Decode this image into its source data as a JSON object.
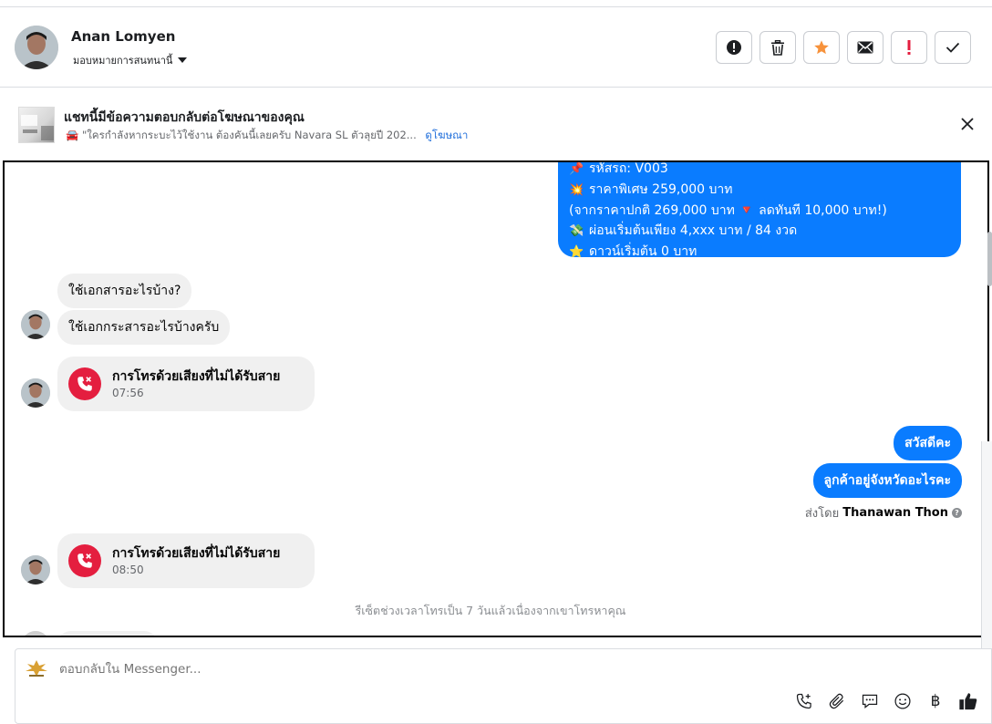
{
  "header": {
    "contact_name": "Anan Lomyen",
    "assign_label": "มอบหมายการสนทนานี้",
    "actions": [
      {
        "name": "report-icon",
        "color": "#1c1e21"
      },
      {
        "name": "trash-icon",
        "color": "#1c1e21"
      },
      {
        "name": "star-icon",
        "color": "#f7923b"
      },
      {
        "name": "mail-icon",
        "color": "#1c1e21"
      },
      {
        "name": "important-icon",
        "color": "#e41e3f"
      },
      {
        "name": "check-icon",
        "color": "#1c1e21"
      }
    ]
  },
  "banner": {
    "title": "แชทนี้มีข้อความตอบกลับต่อโฆษณาของคุณ",
    "subtitle": "🚘 \"ใครกำลังหากระบะไว้ใช้งาน ต้องคันนี้เลยครับ Navara SL ตัวลุยปี 202...",
    "link": "ดูโฆษณา"
  },
  "messages": {
    "promo_lines": [
      {
        "emoji": "📌",
        "text": "รหัสรถ: V003"
      },
      {
        "emoji": "💥",
        "text": "ราคาพิเศษ 259,000 บาท"
      },
      {
        "emoji": "",
        "text": "(จากราคาปกติ 269,000 บาท 🔻 ลดทันที 10,000 บาท!)"
      },
      {
        "emoji": "💸",
        "text": "ผ่อนเริ่มต้นเพียง 4,xxx บาท / 84 งวด"
      },
      {
        "emoji": "⭐",
        "text": "ดาวน์เริ่มต้น 0 บาท"
      }
    ],
    "in_1": "ใช้เอกสารอะไรบ้าง?",
    "in_2": "ใช้เอกกระสารอะไรบ้างครับ",
    "missed_call_title": "การโทรด้วยเสียงที่ไม่ได้รับสาย",
    "missed_call_time_1": "07:56",
    "out_1": "สวัสดีคะ",
    "out_2": "ลูกค้าอยู่จังหวัดอะไรคะ",
    "sent_by_label": "ส่งโดย",
    "sent_by_name": "Thanawan Thon",
    "missed_call_time_2": "08:50",
    "system_note": "รีเซ็ตช่วงเวลาโทรเป็น 7 วันแล้วเนื่องจากเขาโทรหาคุณ"
  },
  "composer": {
    "placeholder": "ตอบกลับใน Messenger...",
    "tools": [
      "call-add-icon",
      "attach-icon",
      "saved-reply-icon",
      "emoji-icon",
      "baht-icon",
      "like-icon"
    ],
    "baht_symbol": "฿"
  },
  "colors": {
    "outgoing_bubble": "#0a7cff",
    "incoming_bubble": "#f0f0f0",
    "missed_call": "#e41e3f",
    "link": "#216fdb"
  }
}
